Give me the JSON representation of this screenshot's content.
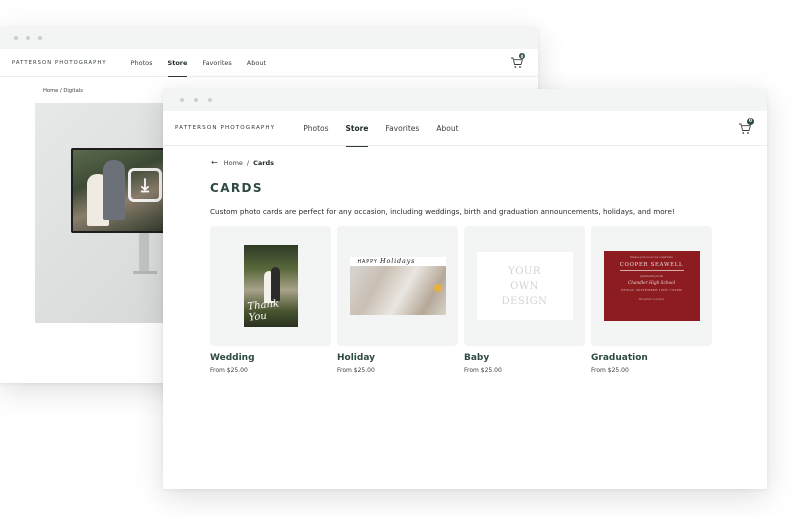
{
  "back_window": {
    "brand": "PATTERSON PHOTOGRAPHY",
    "nav": [
      {
        "label": "Photos"
      },
      {
        "label": "Store",
        "active": true
      },
      {
        "label": "Favorites"
      },
      {
        "label": "About"
      }
    ],
    "cart_count": "0",
    "breadcrumb": "Home / Digitals",
    "icons": {
      "cart": "cart-icon",
      "download": "download-icon"
    }
  },
  "front_window": {
    "brand": "PATTERSON PHOTOGRAPHY",
    "nav": [
      {
        "label": "Photos"
      },
      {
        "label": "Store",
        "active": true
      },
      {
        "label": "Favorites"
      },
      {
        "label": "About"
      }
    ],
    "cart_count": "0",
    "breadcrumb": {
      "back_icon": "←",
      "home": "Home",
      "separator": "/",
      "current": "Cards"
    },
    "page_title": "CARDS",
    "description": "Custom photo cards are perfect for any occasion, including weddings, birth and graduation announcements, holidays, and more!",
    "cards": [
      {
        "name": "Wedding",
        "price": "From $25.00",
        "art_text": "Thank You"
      },
      {
        "name": "Holiday",
        "price": "From $25.00",
        "art_text_a": "HAPPY",
        "art_text_b": "Holidays"
      },
      {
        "name": "Baby",
        "price": "From $25.00",
        "art_lines": [
          "YOUR",
          "OWN",
          "DESIGN"
        ]
      },
      {
        "name": "Graduation",
        "price": "From $25.00",
        "art_name": "COOPER SEAWELL",
        "art_line1": "Please join us as we celebrate",
        "art_line2": "graduating from",
        "art_school": "Chandler High School",
        "art_line3": "FRIDAY, SEPTEMBER 18TH 7:00PM",
        "art_line4": "Reception to follow"
      }
    ]
  },
  "colors": {
    "accent": "#2f4a44",
    "tile_bg": "#f3f5f4",
    "grad_card": "#8c1c1f"
  }
}
